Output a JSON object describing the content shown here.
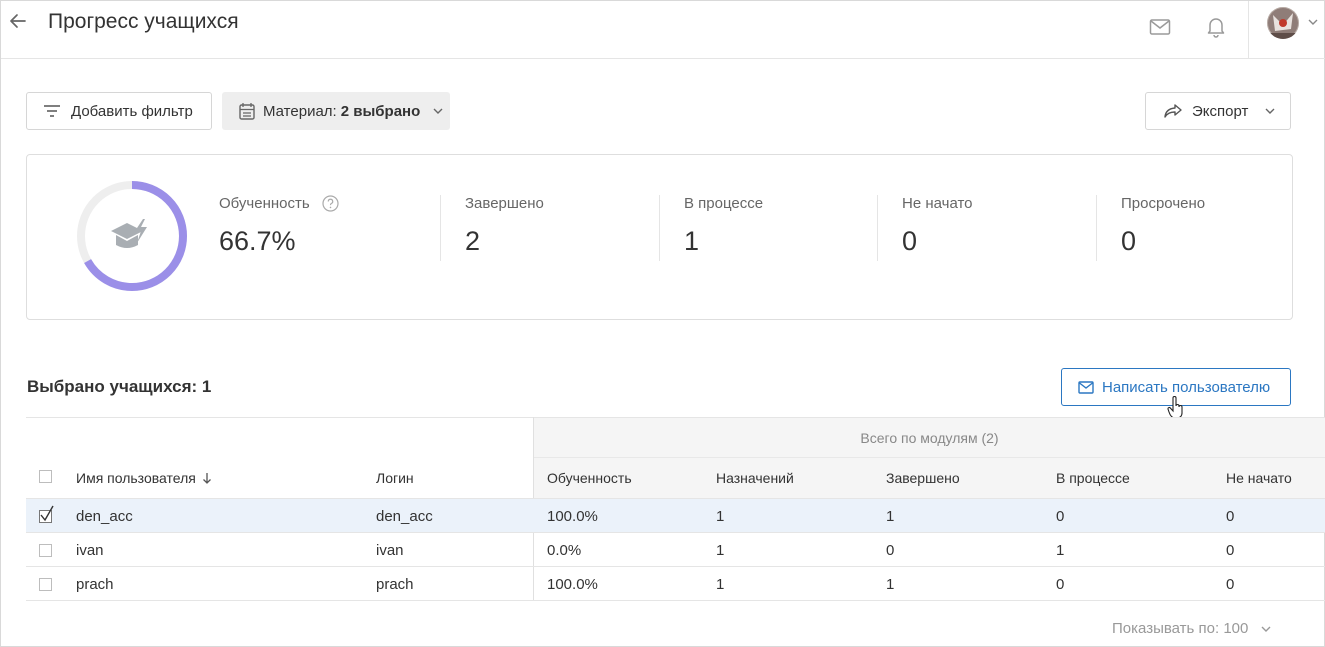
{
  "header": {
    "title": "Прогресс учащихся",
    "icons": [
      "arrow-left-icon",
      "mail-icon",
      "bell-icon",
      "chevron-down-icon"
    ]
  },
  "toolbar": {
    "add_filter": "Добавить фильтр",
    "material_label": "Материал:",
    "material_value": "2 выбрано",
    "export": "Экспорт"
  },
  "summary": {
    "progress_fraction": 0.667,
    "ring_color": "#9b8fe8",
    "stats": [
      {
        "label": "Обученность",
        "value": "66.7%"
      },
      {
        "label": "Завершено",
        "value": "2"
      },
      {
        "label": "В процессе",
        "value": "1"
      },
      {
        "label": "Не начато",
        "value": "0"
      },
      {
        "label": "Просрочено",
        "value": "0"
      }
    ]
  },
  "selection": {
    "label": "Выбрано учащихся: 1",
    "write_user": "Написать пользователю"
  },
  "table": {
    "group_header": "Всего по модулям (2)",
    "columns": {
      "name": "Имя пользователя",
      "login": "Логин",
      "progress": "Обученность",
      "assigned": "Назначений",
      "completed": "Завершено",
      "in_progress": "В процессе",
      "not_started": "Не начато"
    },
    "rows": [
      {
        "name": "den_acc",
        "login": "den_acc",
        "progress": "100.0%",
        "assigned": "1",
        "completed": "1",
        "in_progress": "0",
        "not_started": "0",
        "checked": true
      },
      {
        "name": "ivan",
        "login": "ivan",
        "progress": "0.0%",
        "assigned": "1",
        "completed": "0",
        "in_progress": "1",
        "not_started": "0",
        "checked": false
      },
      {
        "name": "prach",
        "login": "prach",
        "progress": "100.0%",
        "assigned": "1",
        "completed": "1",
        "in_progress": "0",
        "not_started": "0",
        "checked": false
      }
    ]
  },
  "pager": {
    "label": "Показывать по: 100"
  },
  "colors": {
    "accent": "#2b77c2",
    "ring": "#9b8fe8",
    "selected_row": "#ebf2fa"
  }
}
